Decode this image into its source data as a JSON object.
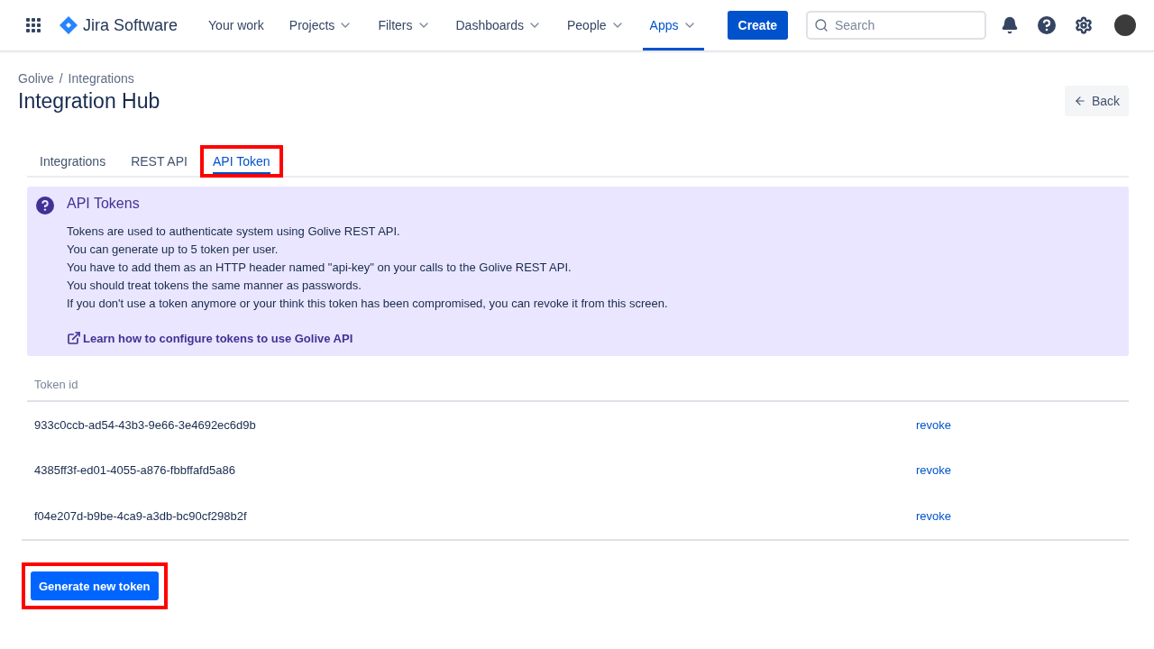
{
  "nav": {
    "product": "Jira Software",
    "items": [
      {
        "label": "Your work",
        "dropdown": false,
        "selected": false
      },
      {
        "label": "Projects",
        "dropdown": true,
        "selected": false
      },
      {
        "label": "Filters",
        "dropdown": true,
        "selected": false
      },
      {
        "label": "Dashboards",
        "dropdown": true,
        "selected": false
      },
      {
        "label": "People",
        "dropdown": true,
        "selected": false
      },
      {
        "label": "Apps",
        "dropdown": true,
        "selected": true
      }
    ],
    "create": "Create",
    "search": {
      "placeholder": "Search"
    }
  },
  "breadcrumbs": [
    "Golive",
    "Integrations"
  ],
  "breadcrumb_separator": "/",
  "title": "Integration Hub",
  "back": "Back",
  "tabs": [
    {
      "label": "Integrations",
      "selected": false,
      "highlighted": false
    },
    {
      "label": "REST API",
      "selected": false,
      "highlighted": false
    },
    {
      "label": "API Token",
      "selected": true,
      "highlighted": true
    }
  ],
  "info": {
    "title": "API Tokens",
    "lines": [
      "Tokens are used to authenticate system using Golive REST API.",
      "You can generate up to 5 token per user.",
      "You have to add them as an HTTP header named \"api-key\" on your calls to the Golive REST API.",
      "You should treat tokens the same manner as passwords.",
      "If you don't use a token anymore or your think this token has been compromised, you can revoke it from this screen."
    ],
    "link": "Learn how to configure tokens to use Golive API"
  },
  "table": {
    "columns": [
      "Token id"
    ],
    "rows": [
      {
        "token": "933c0ccb-ad54-43b3-9e66-3e4692ec6d9b",
        "action": "revoke"
      },
      {
        "token": "4385ff3f-ed01-4055-a876-fbbffafd5a86",
        "action": "revoke"
      },
      {
        "token": "f04e207d-b9be-4ca9-a3db-bc90cf298b2f",
        "action": "revoke"
      }
    ]
  },
  "generate": {
    "label": "Generate new token",
    "highlighted": true
  }
}
